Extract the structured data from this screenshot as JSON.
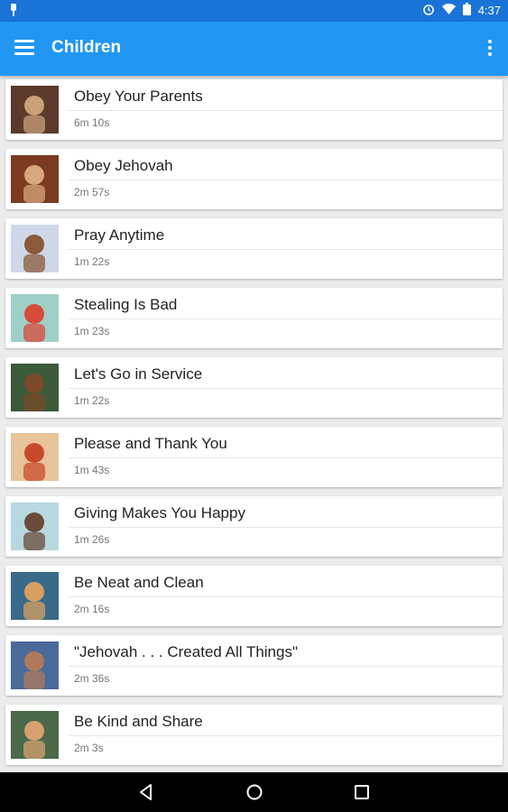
{
  "status_bar": {
    "time": "4:37"
  },
  "app_bar": {
    "title": "Children"
  },
  "videos": [
    {
      "title": "Obey Your Parents",
      "duration": "6m 10s",
      "thumb_bg": "#5a3a2a",
      "thumb_accent": "#c9a27a"
    },
    {
      "title": "Obey Jehovah",
      "duration": "2m 57s",
      "thumb_bg": "#7a3b22",
      "thumb_accent": "#d8a77a"
    },
    {
      "title": "Pray Anytime",
      "duration": "1m 22s",
      "thumb_bg": "#cfd8e8",
      "thumb_accent": "#8a5a3a"
    },
    {
      "title": "Stealing Is Bad",
      "duration": "1m 23s",
      "thumb_bg": "#9fd0c8",
      "thumb_accent": "#d84a3a"
    },
    {
      "title": "Let's Go in Service",
      "duration": "1m 22s",
      "thumb_bg": "#3b5a3a",
      "thumb_accent": "#7a4a2a"
    },
    {
      "title": "Please and Thank You",
      "duration": "1m 43s",
      "thumb_bg": "#e8c49a",
      "thumb_accent": "#c94a2a"
    },
    {
      "title": "Giving Makes You Happy",
      "duration": "1m 26s",
      "thumb_bg": "#b8d8e0",
      "thumb_accent": "#6a4a3a"
    },
    {
      "title": "Be Neat and Clean",
      "duration": "2m 16s",
      "thumb_bg": "#3a6a8a",
      "thumb_accent": "#d8a060"
    },
    {
      "title": "\"Jehovah . . . Created All Things\"",
      "duration": "2m 36s",
      "thumb_bg": "#4a6a9a",
      "thumb_accent": "#b07a5a"
    },
    {
      "title": "Be Kind and Share",
      "duration": "2m 3s",
      "thumb_bg": "#4a6a4a",
      "thumb_accent": "#d8a070"
    }
  ]
}
